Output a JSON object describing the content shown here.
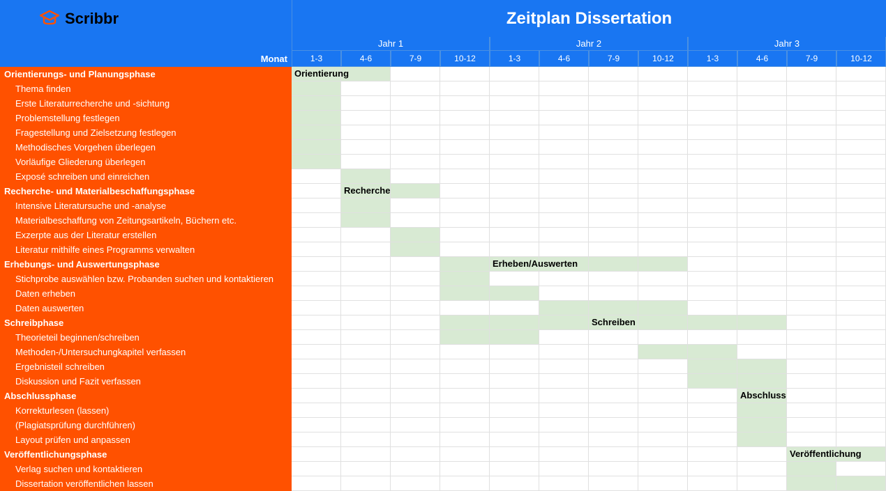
{
  "title": "Zeitplan Dissertation",
  "brand": "Scribbr",
  "monthLabel": "Monat",
  "years": [
    "Jahr 1",
    "Jahr 2",
    "Jahr 3"
  ],
  "months": [
    "1-3",
    "4-6",
    "7-9",
    "10-12",
    "1-3",
    "4-6",
    "7-9",
    "10-12",
    "1-3",
    "4-6",
    "7-9",
    "10-12"
  ],
  "rows": [
    {
      "type": "phase",
      "label": "Orientierungs- und Planungsphase",
      "bar": [
        0,
        1
      ],
      "barLabel": "Orientierung",
      "barLabelCol": 0
    },
    {
      "type": "task",
      "label": "Thema finden",
      "bar": [
        0,
        0
      ]
    },
    {
      "type": "task",
      "label": "Erste Literaturrecherche und -sichtung",
      "bar": [
        0,
        0
      ]
    },
    {
      "type": "task",
      "label": "Problemstellung festlegen",
      "bar": [
        0,
        0
      ]
    },
    {
      "type": "task",
      "label": "Fragestellung und Zielsetzung festlegen",
      "bar": [
        0,
        0
      ]
    },
    {
      "type": "task",
      "label": "Methodisches Vorgehen überlegen",
      "bar": [
        0,
        0
      ]
    },
    {
      "type": "task",
      "label": "Vorläufige Gliederung überlegen",
      "bar": [
        0,
        0
      ]
    },
    {
      "type": "task",
      "label": "Exposé schreiben und einreichen",
      "bar": [
        1,
        1
      ]
    },
    {
      "type": "phase",
      "label": "Recherche- und Materialbeschaffungsphase",
      "bar": [
        1,
        2
      ],
      "barLabel": "Recherche",
      "barLabelCol": 1
    },
    {
      "type": "task",
      "label": "Intensive Literatursuche und -analyse",
      "bar": [
        1,
        1
      ]
    },
    {
      "type": "task",
      "label": "Materialbeschaffung von Zeitungsartikeln, Büchern etc.",
      "bar": [
        1,
        1
      ]
    },
    {
      "type": "task",
      "label": "Exzerpte aus der Literatur erstellen",
      "bar": [
        2,
        2
      ]
    },
    {
      "type": "task",
      "label": "Literatur mithilfe eines Programms verwalten",
      "bar": [
        2,
        2
      ]
    },
    {
      "type": "phase",
      "label": "Erhebungs- und Auswertungsphase",
      "bar": [
        3,
        7
      ],
      "barLabel": "Erheben/Auswerten",
      "barLabelCol": 4
    },
    {
      "type": "task",
      "label": "Stichprobe auswählen bzw. Probanden suchen und kontaktieren",
      "bar": [
        3,
        3
      ]
    },
    {
      "type": "task",
      "label": "Daten erheben",
      "bar": [
        3,
        4
      ]
    },
    {
      "type": "task",
      "label": "Daten auswerten",
      "bar": [
        5,
        7
      ]
    },
    {
      "type": "phase",
      "label": "Schreibphase",
      "bar": [
        3,
        9
      ],
      "barLabel": "Schreiben",
      "barLabelCol": 6
    },
    {
      "type": "task",
      "label": "Theorieteil beginnen/schreiben",
      "bar": [
        3,
        4
      ]
    },
    {
      "type": "task",
      "label": "Methoden-/Untersuchungkapitel verfassen",
      "bar": [
        7,
        8
      ]
    },
    {
      "type": "task",
      "label": "Ergebnisteil schreiben",
      "bar": [
        8,
        9
      ]
    },
    {
      "type": "task",
      "label": "Diskussion und Fazit verfassen",
      "bar": [
        8,
        9
      ]
    },
    {
      "type": "phase",
      "label": "Abschlussphase",
      "bar": [
        9,
        9
      ],
      "barLabel": "Abschluss",
      "barLabelCol": 9
    },
    {
      "type": "task",
      "label": "Korrekturlesen (lassen)",
      "bar": [
        9,
        9
      ]
    },
    {
      "type": "task",
      "label": "(Plagiatsprüfung durchführen)",
      "bar": [
        9,
        9
      ]
    },
    {
      "type": "task",
      "label": "Layout prüfen und anpassen",
      "bar": [
        9,
        9
      ]
    },
    {
      "type": "phase",
      "label": "Veröffentlichungsphase",
      "bar": [
        10,
        11
      ],
      "barLabel": "Veröffentlichung",
      "barLabelCol": 10
    },
    {
      "type": "task",
      "label": "Verlag suchen und kontaktieren",
      "bar": [
        10,
        10
      ]
    },
    {
      "type": "task",
      "label": "Dissertation veröffentlichen lassen",
      "bar": [
        10,
        11
      ]
    }
  ],
  "chart_data": {
    "type": "bar",
    "title": "Zeitplan Dissertation",
    "xlabel": "Monat",
    "categories": [
      "J1 1-3",
      "J1 4-6",
      "J1 7-9",
      "J1 10-12",
      "J2 1-3",
      "J2 4-6",
      "J2 7-9",
      "J2 10-12",
      "J3 1-3",
      "J3 4-6",
      "J3 7-9",
      "J3 10-12"
    ],
    "series": [
      {
        "name": "Orientierungs- und Planungsphase",
        "start": 0,
        "end": 1
      },
      {
        "name": "Thema finden",
        "start": 0,
        "end": 0
      },
      {
        "name": "Erste Literaturrecherche und -sichtung",
        "start": 0,
        "end": 0
      },
      {
        "name": "Problemstellung festlegen",
        "start": 0,
        "end": 0
      },
      {
        "name": "Fragestellung und Zielsetzung festlegen",
        "start": 0,
        "end": 0
      },
      {
        "name": "Methodisches Vorgehen überlegen",
        "start": 0,
        "end": 0
      },
      {
        "name": "Vorläufige Gliederung überlegen",
        "start": 0,
        "end": 0
      },
      {
        "name": "Exposé schreiben und einreichen",
        "start": 1,
        "end": 1
      },
      {
        "name": "Recherche- und Materialbeschaffungsphase",
        "start": 1,
        "end": 2
      },
      {
        "name": "Intensive Literatursuche und -analyse",
        "start": 1,
        "end": 1
      },
      {
        "name": "Materialbeschaffung von Zeitungsartikeln, Büchern etc.",
        "start": 1,
        "end": 1
      },
      {
        "name": "Exzerpte aus der Literatur erstellen",
        "start": 2,
        "end": 2
      },
      {
        "name": "Literatur mithilfe eines Programms verwalten",
        "start": 2,
        "end": 2
      },
      {
        "name": "Erhebungs- und Auswertungsphase",
        "start": 3,
        "end": 7
      },
      {
        "name": "Stichprobe auswählen bzw. Probanden suchen und kontaktieren",
        "start": 3,
        "end": 3
      },
      {
        "name": "Daten erheben",
        "start": 3,
        "end": 4
      },
      {
        "name": "Daten auswerten",
        "start": 5,
        "end": 7
      },
      {
        "name": "Schreibphase",
        "start": 3,
        "end": 9
      },
      {
        "name": "Theorieteil beginnen/schreiben",
        "start": 3,
        "end": 4
      },
      {
        "name": "Methoden-/Untersuchungkapitel verfassen",
        "start": 7,
        "end": 8
      },
      {
        "name": "Ergebnisteil schreiben",
        "start": 8,
        "end": 9
      },
      {
        "name": "Diskussion und Fazit verfassen",
        "start": 8,
        "end": 9
      },
      {
        "name": "Abschlussphase",
        "start": 9,
        "end": 9
      },
      {
        "name": "Korrekturlesen (lassen)",
        "start": 9,
        "end": 9
      },
      {
        "name": "(Plagiatsprüfung durchführen)",
        "start": 9,
        "end": 9
      },
      {
        "name": "Layout prüfen und anpassen",
        "start": 9,
        "end": 9
      },
      {
        "name": "Veröffentlichungsphase",
        "start": 10,
        "end": 11
      },
      {
        "name": "Verlag suchen und kontaktieren",
        "start": 10,
        "end": 10
      },
      {
        "name": "Dissertation veröffentlichen lassen",
        "start": 10,
        "end": 11
      }
    ]
  }
}
